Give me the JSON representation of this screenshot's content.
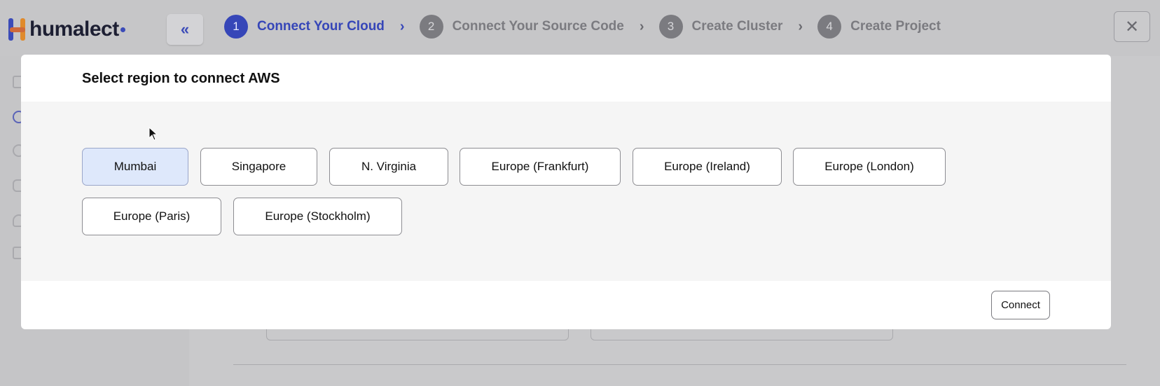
{
  "brand": {
    "name": "humalect",
    "logo_icon": "humalect-logo-icon"
  },
  "topbar": {
    "collapse_icon": "double-chevron-left-icon",
    "steps": [
      {
        "number": "1",
        "label": "Connect Your Cloud",
        "active": true
      },
      {
        "number": "2",
        "label": "Connect Your Source Code",
        "active": false
      },
      {
        "number": "3",
        "label": "Create Cluster",
        "active": false
      },
      {
        "number": "4",
        "label": "Create Project",
        "active": false
      }
    ],
    "step_separator_icon": "chevron-right-icon",
    "close_icon": "close-icon"
  },
  "modal": {
    "title": "Select region to connect AWS",
    "regions": [
      {
        "label": "Mumbai",
        "selected": true
      },
      {
        "label": "Singapore",
        "selected": false
      },
      {
        "label": "N. Virginia",
        "selected": false
      },
      {
        "label": "Europe (Frankfurt)",
        "selected": false
      },
      {
        "label": "Europe (Ireland)",
        "selected": false
      },
      {
        "label": "Europe (London)",
        "selected": false
      },
      {
        "label": "Europe (Paris)",
        "selected": false
      },
      {
        "label": "Europe (Stockholm)",
        "selected": false
      }
    ],
    "connect_label": "Connect"
  },
  "colors": {
    "accent": "#3646b8",
    "selected_region_bg": "#dee8fb",
    "overlay_bg": "#c9c9cb"
  }
}
